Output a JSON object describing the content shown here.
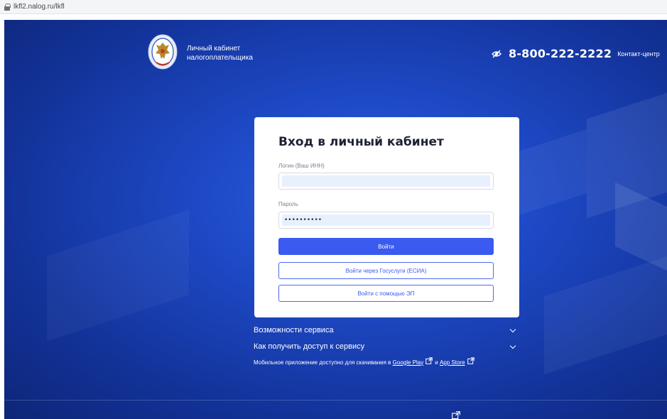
{
  "browser": {
    "url": "lkfl2.nalog.ru/lkfl"
  },
  "header": {
    "brand_line1": "Личный кабинет",
    "brand_line2": "налогоплательщика",
    "phone": "8-800-222-2222",
    "contact_label": "Контакт-центр"
  },
  "login": {
    "title": "Вход в личный кабинет",
    "login_label": "Логин (Ваш ИНН)",
    "login_value": "",
    "password_label": "Пароль",
    "password_value": "••••••••••",
    "submit_label": "Войти",
    "gosuslugi_label": "Войти через Госуслуги (ЕСИА)",
    "ep_label": "Войти с помощью ЭП"
  },
  "info": {
    "features_label": "Возможности сервиса",
    "access_label": "Как получить доступ к сервису",
    "mobile_text": "Мобильное приложение доступно для скачивания в",
    "google_play": "Google Play",
    "and": "и",
    "app_store": "App Store"
  },
  "colors": {
    "primary": "#3b5af0",
    "background": "#1d48c4",
    "card": "#ffffff"
  }
}
